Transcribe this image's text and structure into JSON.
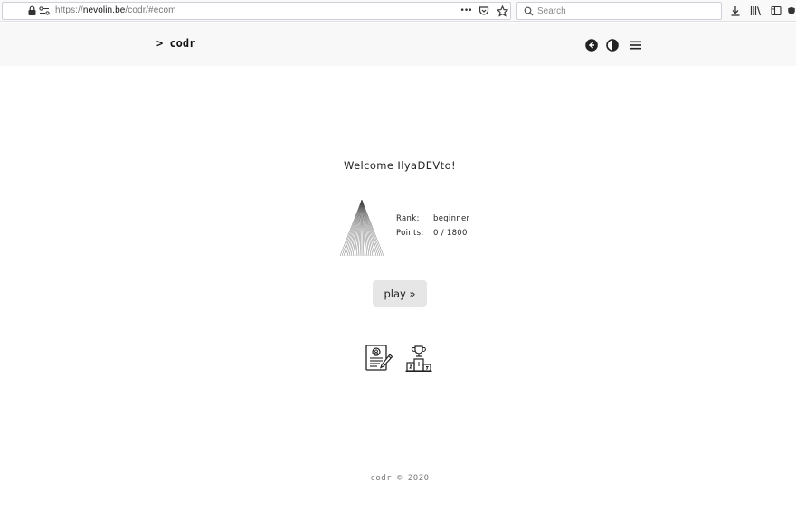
{
  "browser": {
    "url_prefix": "https://",
    "url_host": "nevolin.be",
    "url_path": "/codr/#ecom",
    "search_placeholder": "Search",
    "more_glyph": "•••"
  },
  "header": {
    "logo": "> codr"
  },
  "main": {
    "welcome": "Welcome IlyaDEVto!",
    "rank_label": "Rank:",
    "rank_value": "beginner",
    "points_label": "Points:",
    "points_value": "0 / 1800",
    "play_label": "play »"
  },
  "footer": {
    "text": "codr © 2020"
  },
  "icons": {
    "back": "arrow-left-circle-icon",
    "theme": "contrast-icon",
    "menu": "hamburger-menu-icon",
    "profile": "certificate-icon",
    "leaderboard": "podium-trophy-icon"
  },
  "colors": {
    "header_bg": "#f8f8f8",
    "button_bg": "#e6e6e6",
    "text": "#222222"
  }
}
